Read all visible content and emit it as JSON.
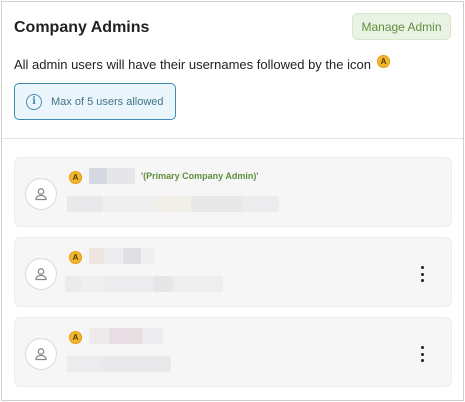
{
  "header": {
    "title": "Company Admins",
    "manage_label": "Manage Admin"
  },
  "description": {
    "text": "All admin users will have their usernames followed by the icon",
    "badge_letter": "A"
  },
  "info": {
    "icon": "info-icon",
    "text": "Max of 5 users allowed"
  },
  "colors": {
    "accent_green": "#5f8f3e",
    "badge": "#f1b62f",
    "info_border": "#3b8bb2"
  },
  "admins": [
    {
      "badge_letter": "A",
      "tag": "'(Primary Company Admin)'",
      "has_menu": false
    },
    {
      "badge_letter": "A",
      "tag": "",
      "has_menu": true
    },
    {
      "badge_letter": "A",
      "tag": "",
      "has_menu": true
    }
  ]
}
